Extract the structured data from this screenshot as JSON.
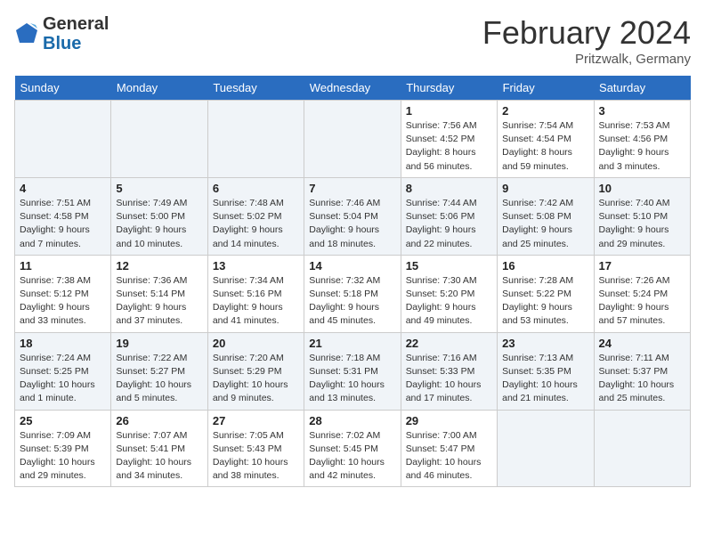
{
  "header": {
    "logo_line1": "General",
    "logo_line2": "Blue",
    "title": "February 2024",
    "subtitle": "Pritzwalk, Germany"
  },
  "days_of_week": [
    "Sunday",
    "Monday",
    "Tuesday",
    "Wednesday",
    "Thursday",
    "Friday",
    "Saturday"
  ],
  "weeks": [
    [
      {
        "day": "",
        "info": ""
      },
      {
        "day": "",
        "info": ""
      },
      {
        "day": "",
        "info": ""
      },
      {
        "day": "",
        "info": ""
      },
      {
        "day": "1",
        "info": "Sunrise: 7:56 AM\nSunset: 4:52 PM\nDaylight: 8 hours\nand 56 minutes."
      },
      {
        "day": "2",
        "info": "Sunrise: 7:54 AM\nSunset: 4:54 PM\nDaylight: 8 hours\nand 59 minutes."
      },
      {
        "day": "3",
        "info": "Sunrise: 7:53 AM\nSunset: 4:56 PM\nDaylight: 9 hours\nand 3 minutes."
      }
    ],
    [
      {
        "day": "4",
        "info": "Sunrise: 7:51 AM\nSunset: 4:58 PM\nDaylight: 9 hours\nand 7 minutes."
      },
      {
        "day": "5",
        "info": "Sunrise: 7:49 AM\nSunset: 5:00 PM\nDaylight: 9 hours\nand 10 minutes."
      },
      {
        "day": "6",
        "info": "Sunrise: 7:48 AM\nSunset: 5:02 PM\nDaylight: 9 hours\nand 14 minutes."
      },
      {
        "day": "7",
        "info": "Sunrise: 7:46 AM\nSunset: 5:04 PM\nDaylight: 9 hours\nand 18 minutes."
      },
      {
        "day": "8",
        "info": "Sunrise: 7:44 AM\nSunset: 5:06 PM\nDaylight: 9 hours\nand 22 minutes."
      },
      {
        "day": "9",
        "info": "Sunrise: 7:42 AM\nSunset: 5:08 PM\nDaylight: 9 hours\nand 25 minutes."
      },
      {
        "day": "10",
        "info": "Sunrise: 7:40 AM\nSunset: 5:10 PM\nDaylight: 9 hours\nand 29 minutes."
      }
    ],
    [
      {
        "day": "11",
        "info": "Sunrise: 7:38 AM\nSunset: 5:12 PM\nDaylight: 9 hours\nand 33 minutes."
      },
      {
        "day": "12",
        "info": "Sunrise: 7:36 AM\nSunset: 5:14 PM\nDaylight: 9 hours\nand 37 minutes."
      },
      {
        "day": "13",
        "info": "Sunrise: 7:34 AM\nSunset: 5:16 PM\nDaylight: 9 hours\nand 41 minutes."
      },
      {
        "day": "14",
        "info": "Sunrise: 7:32 AM\nSunset: 5:18 PM\nDaylight: 9 hours\nand 45 minutes."
      },
      {
        "day": "15",
        "info": "Sunrise: 7:30 AM\nSunset: 5:20 PM\nDaylight: 9 hours\nand 49 minutes."
      },
      {
        "day": "16",
        "info": "Sunrise: 7:28 AM\nSunset: 5:22 PM\nDaylight: 9 hours\nand 53 minutes."
      },
      {
        "day": "17",
        "info": "Sunrise: 7:26 AM\nSunset: 5:24 PM\nDaylight: 9 hours\nand 57 minutes."
      }
    ],
    [
      {
        "day": "18",
        "info": "Sunrise: 7:24 AM\nSunset: 5:25 PM\nDaylight: 10 hours\nand 1 minute."
      },
      {
        "day": "19",
        "info": "Sunrise: 7:22 AM\nSunset: 5:27 PM\nDaylight: 10 hours\nand 5 minutes."
      },
      {
        "day": "20",
        "info": "Sunrise: 7:20 AM\nSunset: 5:29 PM\nDaylight: 10 hours\nand 9 minutes."
      },
      {
        "day": "21",
        "info": "Sunrise: 7:18 AM\nSunset: 5:31 PM\nDaylight: 10 hours\nand 13 minutes."
      },
      {
        "day": "22",
        "info": "Sunrise: 7:16 AM\nSunset: 5:33 PM\nDaylight: 10 hours\nand 17 minutes."
      },
      {
        "day": "23",
        "info": "Sunrise: 7:13 AM\nSunset: 5:35 PM\nDaylight: 10 hours\nand 21 minutes."
      },
      {
        "day": "24",
        "info": "Sunrise: 7:11 AM\nSunset: 5:37 PM\nDaylight: 10 hours\nand 25 minutes."
      }
    ],
    [
      {
        "day": "25",
        "info": "Sunrise: 7:09 AM\nSunset: 5:39 PM\nDaylight: 10 hours\nand 29 minutes."
      },
      {
        "day": "26",
        "info": "Sunrise: 7:07 AM\nSunset: 5:41 PM\nDaylight: 10 hours\nand 34 minutes."
      },
      {
        "day": "27",
        "info": "Sunrise: 7:05 AM\nSunset: 5:43 PM\nDaylight: 10 hours\nand 38 minutes."
      },
      {
        "day": "28",
        "info": "Sunrise: 7:02 AM\nSunset: 5:45 PM\nDaylight: 10 hours\nand 42 minutes."
      },
      {
        "day": "29",
        "info": "Sunrise: 7:00 AM\nSunset: 5:47 PM\nDaylight: 10 hours\nand 46 minutes."
      },
      {
        "day": "",
        "info": ""
      },
      {
        "day": "",
        "info": ""
      }
    ]
  ]
}
